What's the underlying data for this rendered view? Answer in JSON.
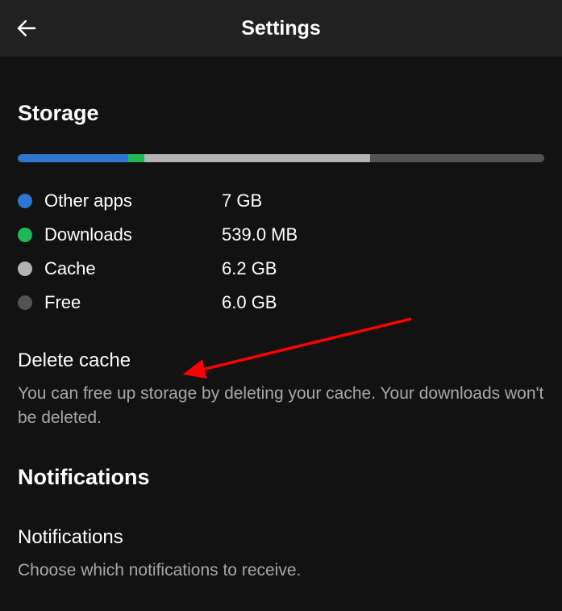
{
  "header": {
    "title": "Settings"
  },
  "storage": {
    "section_title": "Storage",
    "bar": {
      "other_apps_pct": 21,
      "downloads_pct": 3,
      "cache_pct": 43,
      "free_pct": 33
    },
    "legend": [
      {
        "label": "Other apps",
        "value": "7 GB",
        "color": "#2e77d0"
      },
      {
        "label": "Downloads",
        "value": "539.0 MB",
        "color": "#1db954"
      },
      {
        "label": "Cache",
        "value": "6.2 GB",
        "color": "#b3b3b3"
      },
      {
        "label": "Free",
        "value": "6.0 GB",
        "color": "#535353"
      }
    ]
  },
  "delete_cache": {
    "title": "Delete cache",
    "description": "You can free up storage by deleting your cache. Your downloads won't be deleted."
  },
  "notifications": {
    "section_title": "Notifications",
    "item_title": "Notifications",
    "item_description": "Choose which notifications to receive."
  },
  "colors": {
    "other_apps": "#2e77d0",
    "downloads": "#1db954",
    "cache": "#b3b3b3",
    "free": "#535353",
    "annotation": "#ff0000"
  }
}
